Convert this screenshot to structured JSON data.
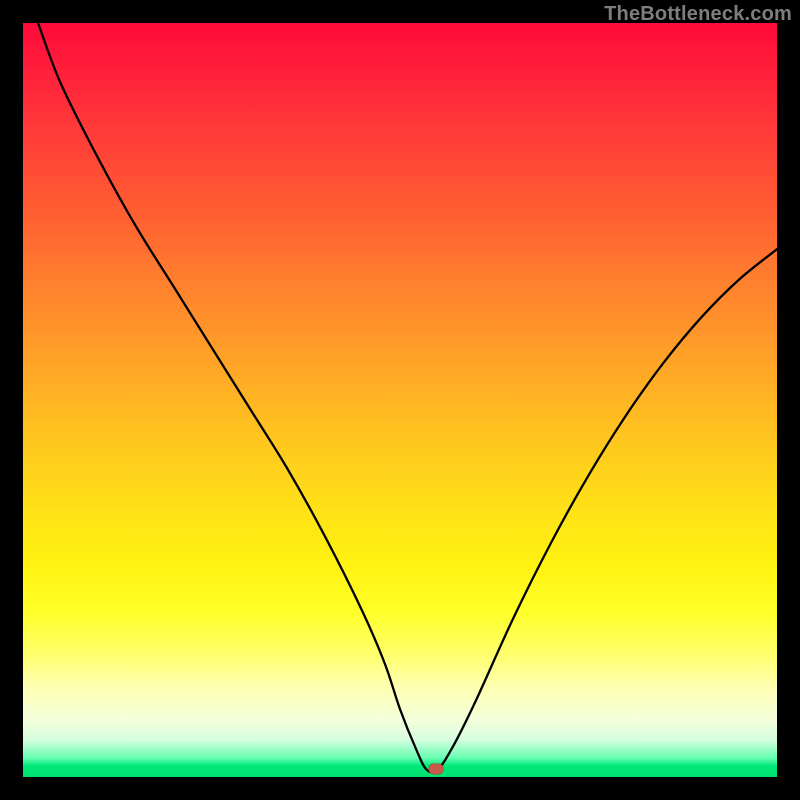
{
  "watermark": "TheBottleneck.com",
  "marker": {
    "x_pct": 54.8,
    "y_pct": 99.0,
    "color": "#c85a4a"
  },
  "chart_data": {
    "type": "line",
    "title": "",
    "xlabel": "",
    "ylabel": "",
    "xlim": [
      0,
      100
    ],
    "ylim": [
      0,
      100
    ],
    "grid": false,
    "legend": false,
    "series": [
      {
        "name": "bottleneck-curve",
        "x": [
          2,
          5,
          10,
          15,
          20,
          25,
          30,
          35,
          40,
          45,
          48,
          50,
          52,
          53.5,
          55,
          57,
          60,
          65,
          70,
          75,
          80,
          85,
          90,
          95,
          100
        ],
        "values": [
          100,
          92,
          82,
          73,
          65,
          57,
          49,
          41,
          32,
          22,
          15,
          9,
          4,
          1,
          1,
          4,
          10,
          21,
          31,
          40,
          48,
          55,
          61,
          66,
          70
        ]
      }
    ],
    "annotations": [
      {
        "type": "marker",
        "x": 54.8,
        "y": 1.0,
        "color": "#c85a4a"
      }
    ]
  }
}
